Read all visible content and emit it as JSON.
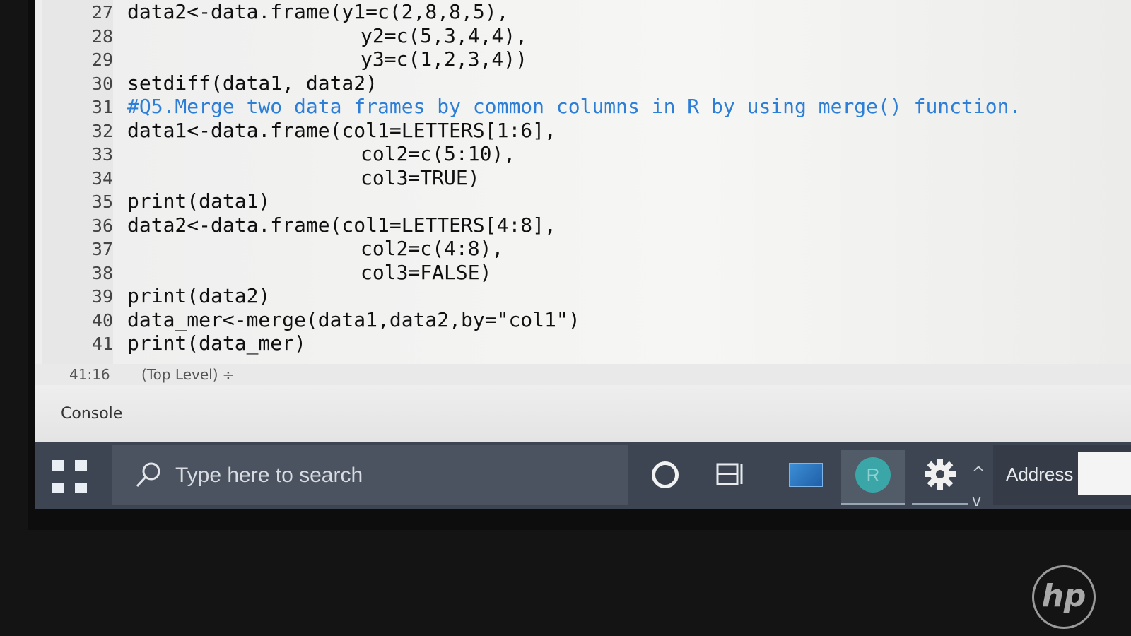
{
  "editor": {
    "lines": [
      {
        "num": "27",
        "code": "data2<-data.frame(y1=c(2,8,8,5),"
      },
      {
        "num": "28",
        "code": "y2=c(5,3,4,4),"
      },
      {
        "num": "29",
        "code": "y3=c(1,2,3,4))"
      },
      {
        "num": "30",
        "code": "setdiff(data1, data2)"
      },
      {
        "num": "31",
        "code": "#Q5.Merge two data frames by common columns in R by using merge() function."
      },
      {
        "num": "32",
        "code": "data1<-data.frame(col1=LETTERS[1:6],"
      },
      {
        "num": "33",
        "code": "col2=c(5:10),"
      },
      {
        "num": "34",
        "code": "col3=TRUE)"
      },
      {
        "num": "35",
        "code": "print(data1)"
      },
      {
        "num": "36",
        "code": "data2<-data.frame(col1=LETTERS[4:8],"
      },
      {
        "num": "37",
        "code": "col2=c(4:8),"
      },
      {
        "num": "38",
        "code": "col3=FALSE)"
      },
      {
        "num": "39",
        "code": "print(data2)"
      },
      {
        "num": "40",
        "code": "data_mer<-merge(data1,data2,by=\"col1\")"
      },
      {
        "num": "41",
        "code": "print(data_mer)"
      }
    ]
  },
  "statusbar": {
    "position": "41:16",
    "scope": "(Top Level)",
    "scope_caret": "÷"
  },
  "console": {
    "label": "Console"
  },
  "taskbar": {
    "search_placeholder": "Type here to search",
    "r_app_letter": "R",
    "address_label": "Address",
    "chevron_up": "^",
    "chevron_down": "v"
  },
  "bezel": {
    "logo": "hp"
  },
  "colors": {
    "comment": "#2c7ed6",
    "taskbar": "#3d4552",
    "r_icon": "#3aa6a8"
  },
  "icons": [
    "windows-start-icon",
    "search-icon",
    "cortana-icon",
    "task-view-icon",
    "gear-icon"
  ]
}
